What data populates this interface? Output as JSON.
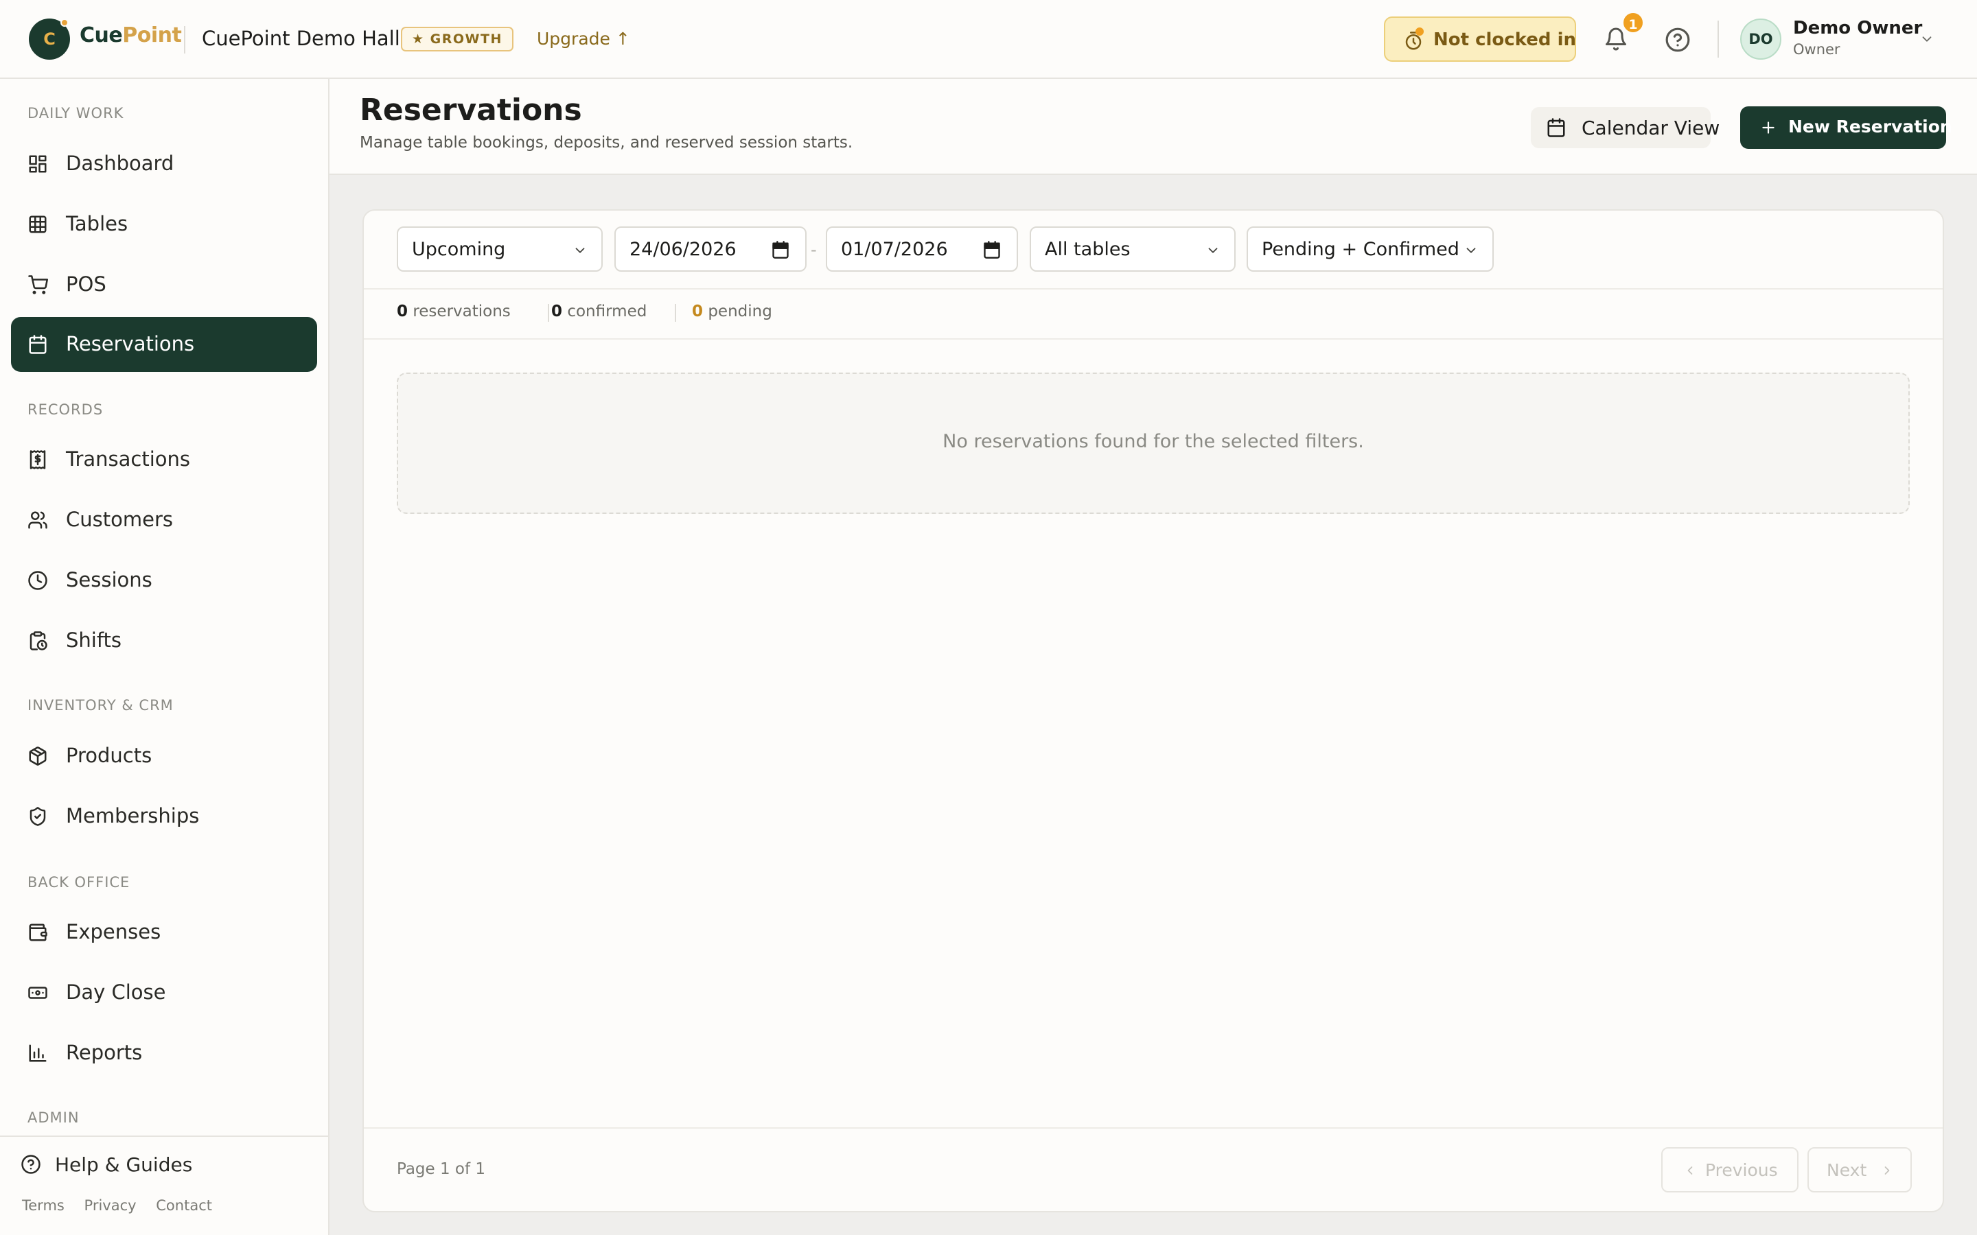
{
  "brand": {
    "logo_letter": "C",
    "name_part1": "Cue",
    "name_part2": "Point",
    "venue": "CuePoint Demo Hall",
    "plan": "★ GROWTH",
    "upgrade": "Upgrade ↑"
  },
  "topbar": {
    "clock_status": "Not clocked in",
    "notification_count": "1",
    "user": {
      "initials": "DO",
      "name": "Demo Owner",
      "role": "Owner"
    }
  },
  "sidebar": {
    "sections": [
      {
        "label": "DAILY WORK",
        "items": [
          {
            "label": "Dashboard",
            "icon": "dashboard-icon"
          },
          {
            "label": "Tables",
            "icon": "table-grid-icon"
          },
          {
            "label": "POS",
            "icon": "cart-icon"
          },
          {
            "label": "Reservations",
            "icon": "calendar-icon",
            "active": true
          }
        ]
      },
      {
        "label": "RECORDS",
        "items": [
          {
            "label": "Transactions",
            "icon": "receipt-icon"
          },
          {
            "label": "Customers",
            "icon": "users-icon"
          },
          {
            "label": "Sessions",
            "icon": "clock-icon"
          },
          {
            "label": "Shifts",
            "icon": "clipboard-clock-icon"
          }
        ]
      },
      {
        "label": "INVENTORY & CRM",
        "items": [
          {
            "label": "Products",
            "icon": "box-icon"
          },
          {
            "label": "Memberships",
            "icon": "shield-check-icon"
          }
        ]
      },
      {
        "label": "BACK OFFICE",
        "items": [
          {
            "label": "Expenses",
            "icon": "wallet-icon"
          },
          {
            "label": "Day Close",
            "icon": "banknote-icon"
          },
          {
            "label": "Reports",
            "icon": "bar-chart-icon"
          }
        ]
      },
      {
        "label": "ADMIN",
        "items": []
      }
    ],
    "help": "Help & Guides",
    "footer_links": [
      "Terms",
      "Privacy",
      "Contact"
    ]
  },
  "page": {
    "title": "Reservations",
    "subtitle": "Manage table bookings, deposits, and reserved session starts.",
    "calendar_view_label": "Calendar View",
    "new_reservation_label": "New Reservation"
  },
  "filters": {
    "scope": "Upcoming",
    "date_from": "24/06/2026",
    "date_separator": "-",
    "date_to": "01/07/2026",
    "table": "All tables",
    "status": "Pending + Confirmed"
  },
  "stats": {
    "reservations_count": "0",
    "reservations_label": "reservations",
    "confirmed_count": "0",
    "confirmed_label": "confirmed",
    "pending_count": "0",
    "pending_label": "pending"
  },
  "empty_message": "No reservations found for the selected filters.",
  "pagination": {
    "page_info": "Page 1 of 1",
    "previous": "Previous",
    "next": "Next"
  },
  "colors": {
    "brand_dark": "#1b3a2e",
    "brand_gold": "#d4a24a",
    "warning_bg": "#fbeec0",
    "pending": "#c4891e"
  }
}
